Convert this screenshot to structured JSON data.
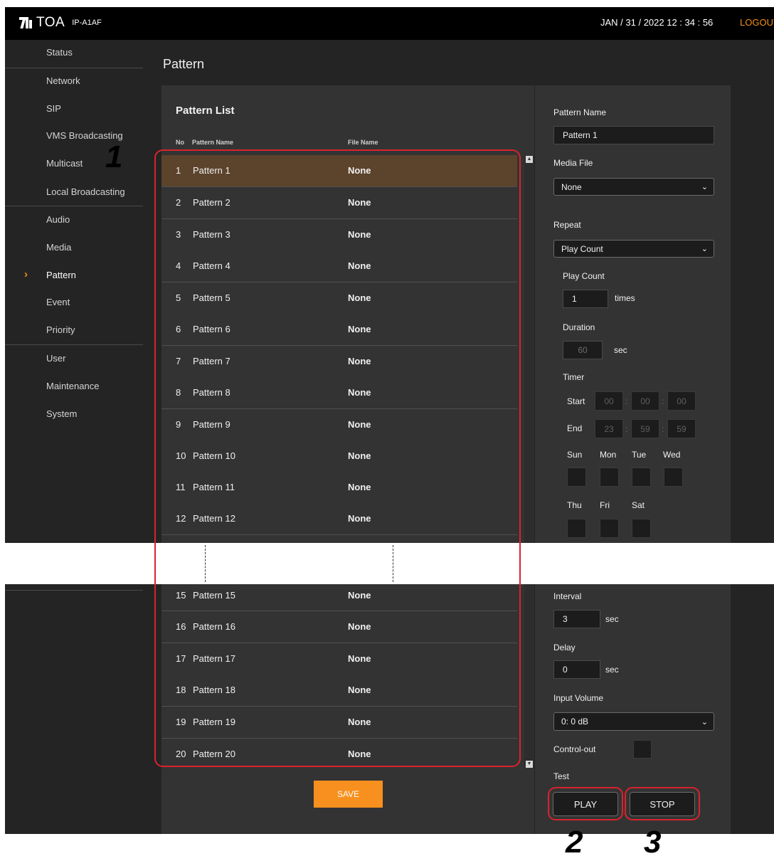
{
  "header": {
    "brand": "TOA",
    "model": "IP-A1AF",
    "datetime": "JAN / 31 / 2022   12 : 34 : 56",
    "logout": "LOGOUT"
  },
  "sidebar": {
    "items": [
      {
        "label": "Status"
      },
      {
        "label": "Network"
      },
      {
        "label": "SIP"
      },
      {
        "label": "VMS Broadcasting"
      },
      {
        "label": "Multicast"
      },
      {
        "label": "Local Broadcasting"
      },
      {
        "label": "Audio"
      },
      {
        "label": "Media"
      },
      {
        "label": "Pattern",
        "active": true
      },
      {
        "label": "Event"
      },
      {
        "label": "Priority"
      },
      {
        "label": "User"
      },
      {
        "label": "Maintenance"
      },
      {
        "label": "System"
      }
    ]
  },
  "page": {
    "title": "Pattern"
  },
  "pattern_list": {
    "title": "Pattern List",
    "columns": {
      "no": "No",
      "name": "Pattern Name",
      "file": "File Name"
    },
    "rows": [
      {
        "no": "1",
        "name": "Pattern 1",
        "file": "None",
        "selected": true
      },
      {
        "no": "2",
        "name": "Pattern 2",
        "file": "None"
      },
      {
        "no": "3",
        "name": "Pattern 3",
        "file": "None"
      },
      {
        "no": "4",
        "name": "Pattern 4",
        "file": "None"
      },
      {
        "no": "5",
        "name": "Pattern 5",
        "file": "None"
      },
      {
        "no": "6",
        "name": "Pattern 6",
        "file": "None"
      },
      {
        "no": "7",
        "name": "Pattern 7",
        "file": "None"
      },
      {
        "no": "8",
        "name": "Pattern 8",
        "file": "None"
      },
      {
        "no": "9",
        "name": "Pattern 9",
        "file": "None"
      },
      {
        "no": "10",
        "name": "Pattern 10",
        "file": "None"
      },
      {
        "no": "11",
        "name": "Pattern 11",
        "file": "None"
      },
      {
        "no": "12",
        "name": "Pattern 12",
        "file": "None"
      }
    ],
    "rows_lower": [
      {
        "no": "15",
        "name": "Pattern 15",
        "file": "None"
      },
      {
        "no": "16",
        "name": "Pattern 16",
        "file": "None"
      },
      {
        "no": "17",
        "name": "Pattern 17",
        "file": "None"
      },
      {
        "no": "18",
        "name": "Pattern 18",
        "file": "None"
      },
      {
        "no": "19",
        "name": "Pattern 19",
        "file": "None"
      },
      {
        "no": "20",
        "name": "Pattern 20",
        "file": "None"
      }
    ],
    "save_label": "SAVE"
  },
  "settings": {
    "pattern_name_label": "Pattern Name",
    "pattern_name_value": "Pattern 1",
    "media_file_label": "Media File",
    "media_file_value": "None",
    "repeat_label": "Repeat",
    "repeat_value": "Play Count",
    "play_count_label": "Play Count",
    "play_count_value": "1",
    "times_unit": "times",
    "duration_label": "Duration",
    "duration_value": "60",
    "sec_unit": "sec",
    "timer_label": "Timer",
    "start_label": "Start",
    "start_hh": "00",
    "start_mm": "00",
    "start_ss": "00",
    "end_label": "End",
    "end_hh": "23",
    "end_mm": "59",
    "end_ss": "59",
    "colon": ":",
    "days_row1": [
      "Sun",
      "Mon",
      "Tue",
      "Wed"
    ],
    "days_row2": [
      "Thu",
      "Fri",
      "Sat"
    ],
    "interval_label": "Interval",
    "interval_value": "3",
    "delay_label": "Delay",
    "delay_value": "0",
    "input_volume_label": "Input Volume",
    "input_volume_value": "0: 0 dB",
    "control_out_label": "Control-out",
    "test_label": "Test",
    "play_label": "PLAY",
    "stop_label": "STOP"
  },
  "callouts": {
    "one": "1",
    "two": "2",
    "three": "3"
  },
  "colors": {
    "accent": "#f29015",
    "selected_row": "#5c432c",
    "highlight": "#d9232d"
  }
}
